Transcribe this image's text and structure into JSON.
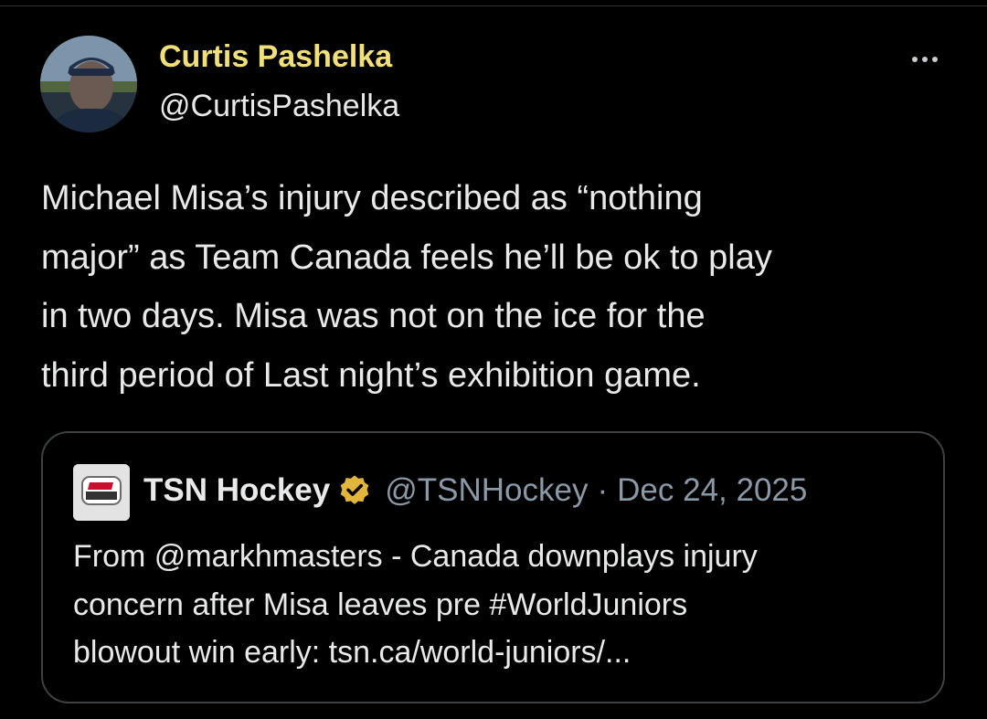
{
  "tweet": {
    "author_name": "Curtis Pashelka",
    "author_handle": "@CurtisPashelka",
    "more_icon": "more-horizontal-icon",
    "text_lines": [
      "Michael Misa’s injury described as “nothing",
      "major” as Team Canada feels he’ll be ok to play",
      "in two days. Misa was not on the ice for the",
      "third period of Last night’s exhibition game."
    ]
  },
  "quote": {
    "avatar_text": "TSN HOCKEY",
    "name": "TSN Hockey",
    "verified_icon": "verified-badge-icon",
    "handle": "@TSNHockey",
    "separator": "·",
    "date": "Dec 24, 2025",
    "text_lines": [
      "From @markhmasters - Canada downplays injury",
      "concern after Misa leaves pre #WorldJuniors",
      "blowout win early: tsn.ca/world-juniors/..."
    ]
  },
  "colors": {
    "background": "#000000",
    "author_name": "#f1e07a",
    "text": "#e7e9ea",
    "muted": "#8b98a5",
    "border": "#3e4144",
    "verified": "#e2b53c"
  }
}
